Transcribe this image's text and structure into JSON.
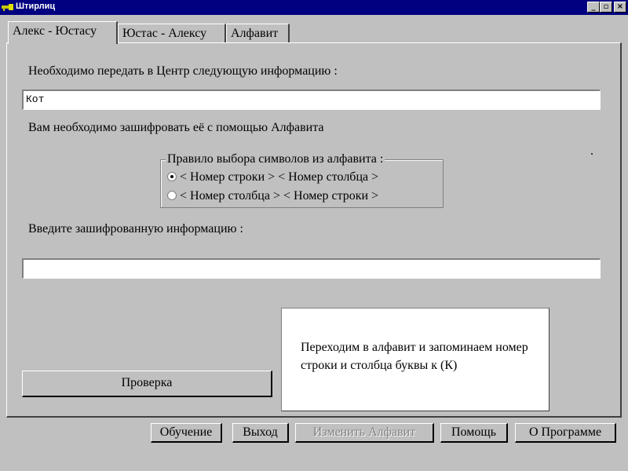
{
  "window": {
    "title": "Штирлиц",
    "min_label": "_",
    "max_label": "▫",
    "close_label": "×"
  },
  "tabs": [
    {
      "label": "Алекс - Юстасу",
      "active": true
    },
    {
      "label": "Юстас - Алексу",
      "active": false
    },
    {
      "label": "Алфавит",
      "active": false
    }
  ],
  "main": {
    "send_label": "Необходимо передать в Центр следующую информацию :",
    "message_value": "Кот",
    "encrypt_label": "Вам необходимо зашифровать её с помощью Алфавита",
    "rule_group": {
      "title": "Правило выбора символов из алфавита :",
      "options": [
        {
          "label": "< Номер строки > < Номер столбца >",
          "checked": true
        },
        {
          "label": "< Номер столбца > < Номер строки >",
          "checked": false
        }
      ]
    },
    "enter_label": "Введите зашифрованную информацию :",
    "answer_value": "",
    "check_button": "Проверка",
    "hint": "Переходим в алфавит и запоминаем номер строки и столбца буквы к (К)"
  },
  "bottom_buttons": {
    "training": "Обучение",
    "exit": "Выход",
    "change_alphabet": "Изменить Алфавит",
    "help": "Помощь",
    "about": "О Программе"
  }
}
